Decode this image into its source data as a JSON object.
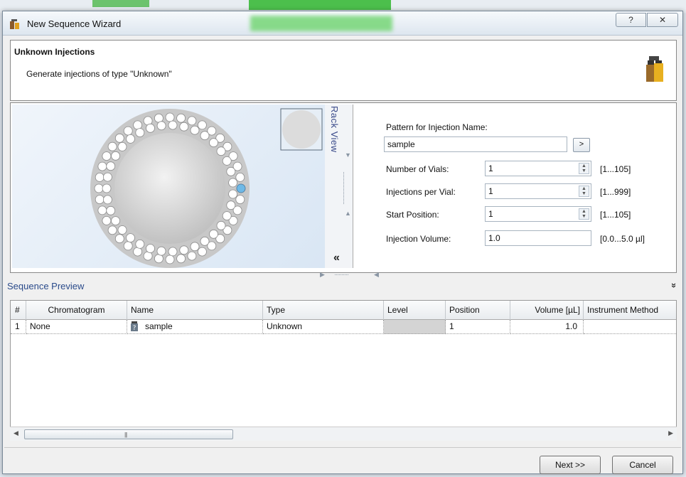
{
  "window": {
    "title": "New Sequence Wizard",
    "help_btn": "?",
    "close_btn": "✕"
  },
  "header": {
    "title": "Unknown Injections",
    "subtitle": "Generate injections of type \"Unknown\""
  },
  "rack": {
    "view_label": "Rack View",
    "collapse_label": "«"
  },
  "form": {
    "pattern_label": "Pattern for Injection Name:",
    "pattern_value": "sample",
    "pattern_btn": ">",
    "vials_label": "Number of Vials:",
    "vials_value": "1",
    "vials_range": "[1...105]",
    "injections_label": "Injections per Vial:",
    "injections_value": "1",
    "injections_range": "[1...999]",
    "start_label": "Start Position:",
    "start_value": "1",
    "start_range": "[1...105]",
    "volume_label": "Injection Volume:",
    "volume_value": "1.0",
    "volume_range": "[0.0...5.0 µl]"
  },
  "preview": {
    "title": "Sequence Preview",
    "toggle": "»",
    "columns": [
      "#",
      "Chromatogram",
      "Name",
      "Type",
      "Level",
      "Position",
      "Volume [µL]",
      "Instrument Method"
    ],
    "rows": [
      {
        "num": "1",
        "chromatogram": "None",
        "name": "sample",
        "type": "Unknown",
        "level": "",
        "position": "1",
        "volume": "1.0",
        "method": ""
      }
    ]
  },
  "buttons": {
    "next": "Next >>",
    "cancel": "Cancel"
  },
  "colors": {
    "accent": "#2a4a8a",
    "selected_vial": "#6fb9e6"
  }
}
